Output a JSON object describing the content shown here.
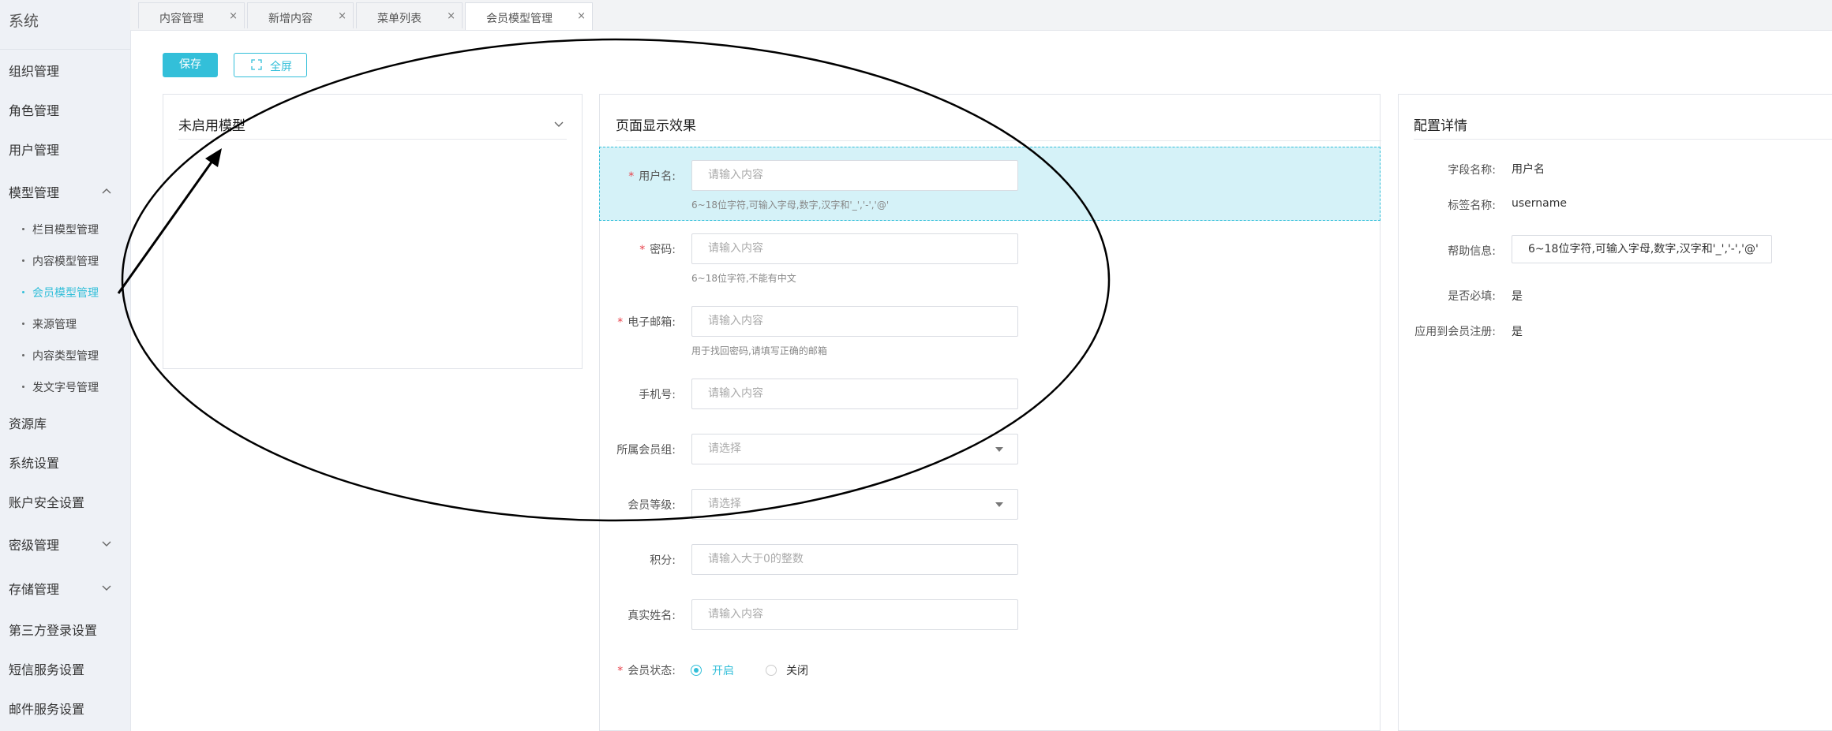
{
  "sidebar": {
    "title": "系统",
    "items": [
      {
        "label": "组织管理"
      },
      {
        "label": "角色管理"
      },
      {
        "label": "用户管理"
      },
      {
        "label": "模型管理"
      },
      {
        "label": "资源库"
      },
      {
        "label": "系统设置"
      },
      {
        "label": "账户安全设置"
      },
      {
        "label": "密级管理"
      },
      {
        "label": "存储管理"
      },
      {
        "label": "第三方登录设置"
      },
      {
        "label": "短信服务设置"
      },
      {
        "label": "邮件服务设置"
      }
    ],
    "sub_items": [
      {
        "label": "栏目模型管理"
      },
      {
        "label": "内容模型管理"
      },
      {
        "label": "会员模型管理"
      },
      {
        "label": "来源管理"
      },
      {
        "label": "内容类型管理"
      },
      {
        "label": "发文字号管理"
      }
    ]
  },
  "tabs": [
    {
      "label": "内容管理",
      "close": "×"
    },
    {
      "label": "新增内容",
      "close": "×"
    },
    {
      "label": "菜单列表",
      "close": "×"
    },
    {
      "label": "会员模型管理",
      "close": "×"
    }
  ],
  "toolbar": {
    "save_label": "保存",
    "fullscreen_label": "全屏"
  },
  "left_panel": {
    "title": "未启用模型"
  },
  "center_panel": {
    "title": "页面显示效果",
    "fields": {
      "username": {
        "label": "用户名:",
        "placeholder": "请输入内容",
        "hint": "6~18位字符,可输入字母,数字,汉字和'_','-','@'"
      },
      "password": {
        "label": "密码:",
        "placeholder": "请输入内容",
        "hint": "6~18位字符,不能有中文"
      },
      "email": {
        "label": "电子邮箱:",
        "placeholder": "请输入内容",
        "hint": "用于找回密码,请填写正确的邮箱"
      },
      "phone": {
        "label": "手机号:",
        "placeholder": "请输入内容"
      },
      "group": {
        "label": "所属会员组:",
        "placeholder": "请选择"
      },
      "level": {
        "label": "会员等级:",
        "placeholder": "请选择"
      },
      "points": {
        "label": "积分:",
        "placeholder": "请输入大于0的整数"
      },
      "realname": {
        "label": "真实姓名:",
        "placeholder": "请输入内容"
      },
      "status": {
        "label": "会员状态:",
        "on": "开启",
        "off": "关闭"
      }
    },
    "required_mark": "*"
  },
  "right_panel": {
    "title": "配置详情",
    "field_name_label": "字段名称:",
    "field_name": "用户名",
    "tag_name_label": "标签名称:",
    "tag_name": "username",
    "help_label": "帮助信息:",
    "help_value": "6~18位字符,可输入字母,数字,汉字和'_','-','@'",
    "required_label": "是否必填:",
    "required_value": "是",
    "apply_label": "应用到会员注册:",
    "apply_value": "是"
  },
  "colors": {
    "accent": "#33bfd9",
    "required": "#e8414a",
    "highlight_bg": "#d5f2f8"
  }
}
